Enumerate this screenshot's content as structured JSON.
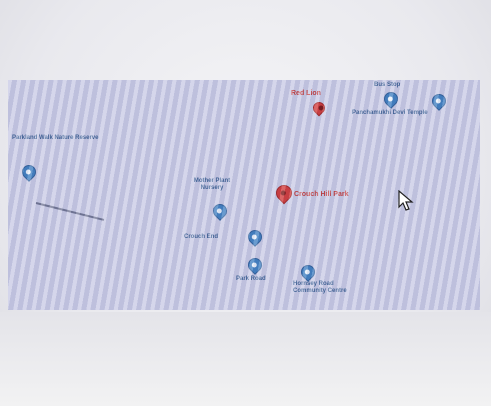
{
  "map": {
    "poi_left": "Parkland Walk Nature Reserve",
    "poi_center": "Mother Plant Nursery",
    "poi_blue_label": "Crouch End",
    "poi_bottom_a": "Park Road",
    "poi_bottom_b": "Hornsey Road Community Centre",
    "poi_top_red": "Red Lion",
    "poi_top_right_a": "Bus Stop",
    "poi_top_right_b": "Panchamukhi Devi Temple",
    "selected_place": "Crouch Hill Park",
    "selected_color": "#d23a3a",
    "poi_color": "#3f7fc2"
  }
}
